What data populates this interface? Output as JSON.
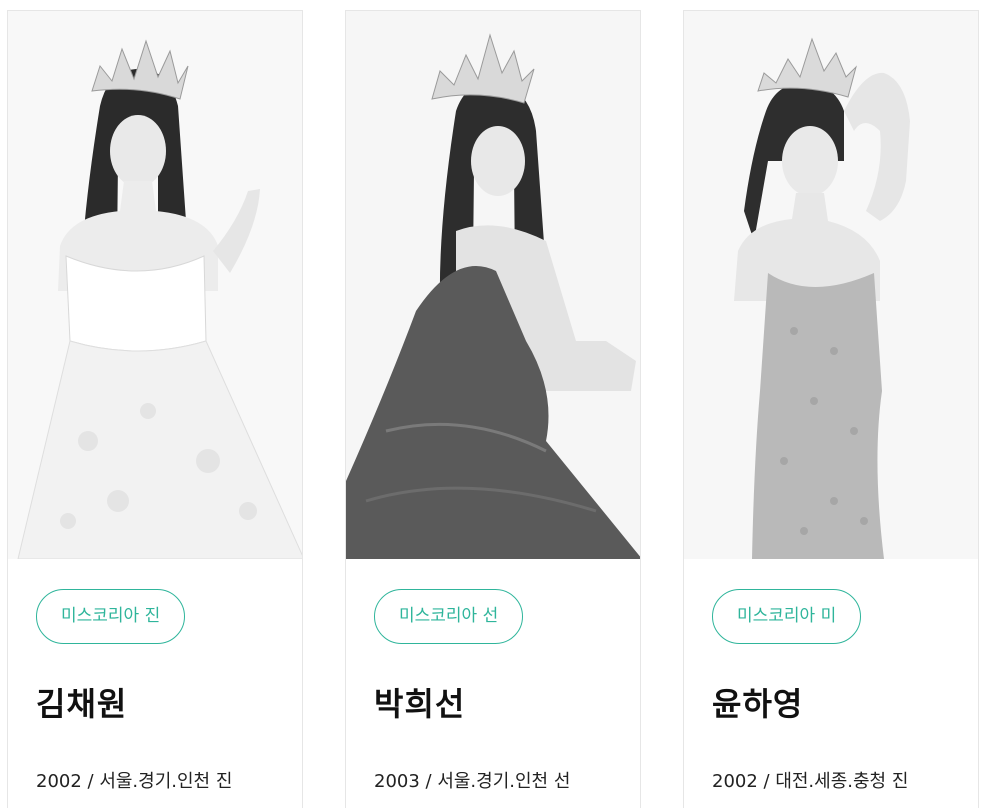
{
  "contestants": [
    {
      "badge": "미스코리아 진",
      "name": "김채원",
      "info": "2002 / 서울.경기.인천 진",
      "photo_alt": "crown-portrait-1"
    },
    {
      "badge": "미스코리아 선",
      "name": "박희선",
      "info": "2003 / 서울.경기.인천 선",
      "photo_alt": "crown-portrait-2"
    },
    {
      "badge": "미스코리아 미",
      "name": "윤하영",
      "info": "2002 / 대전.세종.충청 진",
      "photo_alt": "crown-portrait-3"
    }
  ],
  "colors": {
    "accent": "#2fb59b",
    "text": "#111111",
    "border": "#e6e6e6"
  }
}
